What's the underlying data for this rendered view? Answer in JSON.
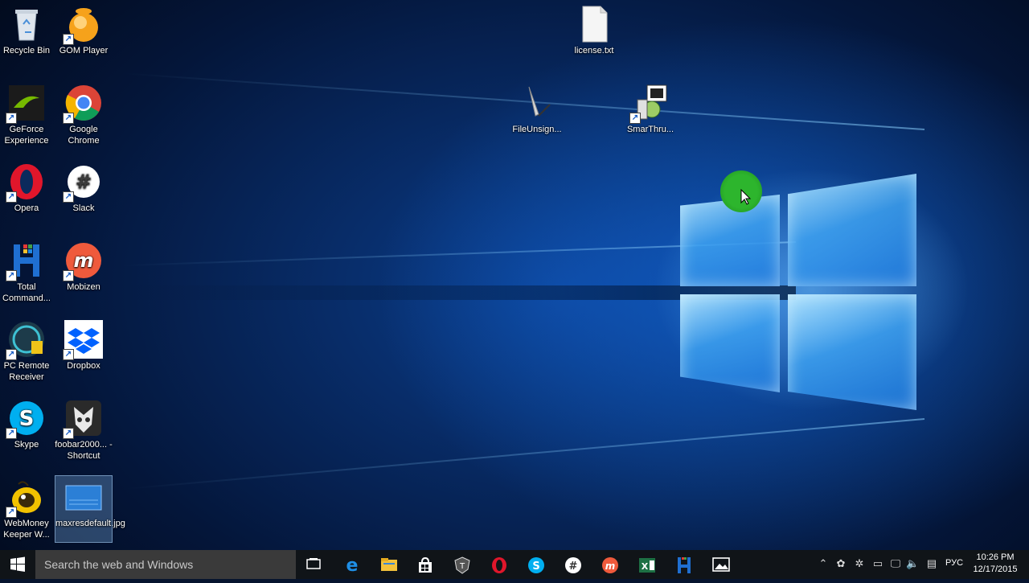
{
  "desktop": {
    "icons_left": [
      {
        "label": "Recycle Bin",
        "icon": "recycle-bin-icon"
      },
      {
        "label": "GOM Player",
        "icon": "gom-player-icon"
      },
      {
        "label": "GeForce Experience",
        "icon": "geforce-icon"
      },
      {
        "label": "Google Chrome",
        "icon": "chrome-icon"
      },
      {
        "label": "Opera",
        "icon": "opera-icon"
      },
      {
        "label": "Slack",
        "icon": "slack-icon"
      },
      {
        "label": "Total Command...",
        "icon": "total-commander-icon"
      },
      {
        "label": "Mobizen",
        "icon": "mobizen-icon"
      },
      {
        "label": "PC Remote Receiver",
        "icon": "pc-remote-icon"
      },
      {
        "label": "Dropbox",
        "icon": "dropbox-icon"
      },
      {
        "label": "Skype",
        "icon": "skype-icon"
      },
      {
        "label": "foobar2000... - Shortcut",
        "icon": "foobar-icon"
      },
      {
        "label": "WebMoney Keeper W...",
        "icon": "webmoney-icon"
      },
      {
        "label": "maxresdefault.jpg",
        "icon": "image-file-icon"
      }
    ],
    "icons_center": [
      {
        "label": "license.txt",
        "icon": "text-file-icon"
      },
      {
        "label": "FileUnsign...",
        "icon": "fileunsigner-icon"
      },
      {
        "label": "SmarThru...",
        "icon": "smarthru-icon"
      }
    ],
    "colors": {
      "accent": "#1e90ff",
      "cursor_highlight": "#2db52d"
    }
  },
  "taskbar": {
    "search_placeholder": "Search the web and Windows",
    "pinned": [
      "task-view-icon",
      "edge-icon",
      "file-explorer-icon",
      "store-icon",
      "world-of-tanks-icon",
      "opera-icon",
      "skype-icon",
      "slack-icon",
      "mobizen-icon",
      "excel-icon",
      "total-commander-icon",
      "photos-icon"
    ],
    "tray": {
      "language": "РУС",
      "time": "10:26 PM",
      "date": "12/17/2015"
    }
  }
}
